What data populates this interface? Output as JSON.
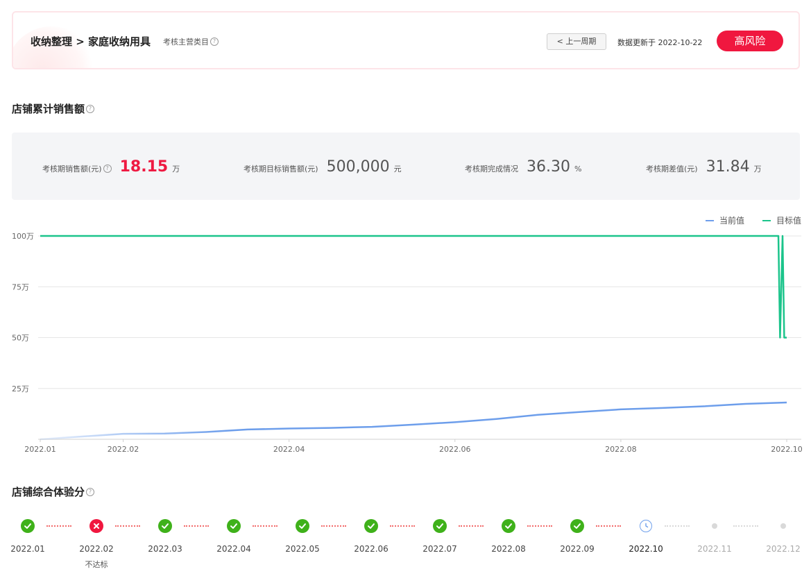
{
  "header": {
    "breadcrumb": "收纳整理 > 家庭收纳用具",
    "category_label": "考核主营类目",
    "prev_period_button": "< 上一周期",
    "update_text": "数据更新于 2022-10-22",
    "risk_button": "高风险",
    "risk_color": "#f0173f"
  },
  "sales_section": {
    "title": "店铺累计销售额",
    "metrics": [
      {
        "label": "考核期销售额(元)",
        "value": "18.15",
        "unit": "万",
        "highlight": true,
        "help": true
      },
      {
        "label": "考核期目标销售额(元)",
        "value": "500,000",
        "unit": "元",
        "highlight": false,
        "help": false
      },
      {
        "label": "考核期完成情况",
        "value": "36.30",
        "unit": "%",
        "highlight": false,
        "help": false
      },
      {
        "label": "考核期差值(元)",
        "value": "31.84",
        "unit": "万",
        "highlight": false,
        "help": false
      }
    ]
  },
  "chart_data": {
    "type": "line",
    "y_ticks": [
      "100万",
      "75万",
      "50万",
      "25万"
    ],
    "ylim": [
      0,
      100
    ],
    "x_ticks": [
      "2022.01",
      "2022.02",
      "2022.04",
      "2022.06",
      "2022.08",
      "2022.10"
    ],
    "xlim": [
      0,
      9
    ],
    "grid": true,
    "legend_position": "top-right",
    "series": [
      {
        "name": "当前值",
        "color": "#6d9eeb",
        "x": [
          0,
          1,
          1.5,
          2,
          2.5,
          3,
          3.5,
          4,
          4.5,
          5,
          5.5,
          6,
          6.5,
          7,
          7.5,
          8,
          8.5,
          9
        ],
        "y": [
          0,
          2.7,
          2.8,
          3.6,
          4.8,
          5.3,
          5.6,
          6.1,
          7.2,
          8.4,
          10.0,
          12.0,
          13.4,
          14.7,
          15.4,
          16.2,
          17.4,
          18.1
        ]
      },
      {
        "name": "目标值",
        "color": "#1bc48b",
        "x": [
          0,
          8.9,
          8.92,
          8.95,
          8.97,
          9
        ],
        "y": [
          100,
          100,
          50,
          100,
          50,
          50
        ]
      }
    ]
  },
  "experience_section": {
    "title": "店铺综合体验分",
    "steps": [
      {
        "month": "2022.01",
        "status": "pass",
        "note": ""
      },
      {
        "month": "2022.02",
        "status": "fail",
        "note": "不达标"
      },
      {
        "month": "2022.03",
        "status": "pass",
        "note": ""
      },
      {
        "month": "2022.04",
        "status": "pass",
        "note": ""
      },
      {
        "month": "2022.05",
        "status": "pass",
        "note": ""
      },
      {
        "month": "2022.06",
        "status": "pass",
        "note": ""
      },
      {
        "month": "2022.07",
        "status": "pass",
        "note": ""
      },
      {
        "month": "2022.08",
        "status": "pass",
        "note": ""
      },
      {
        "month": "2022.09",
        "status": "pass",
        "note": ""
      },
      {
        "month": "2022.10",
        "status": "current",
        "note": ""
      },
      {
        "month": "2022.11",
        "status": "future",
        "note": ""
      },
      {
        "month": "2022.12",
        "status": "future",
        "note": ""
      }
    ],
    "colors": {
      "pass": "#3fb11a",
      "fail": "#f0173f",
      "current": "#6d9eeb",
      "future": "#d9d9d9",
      "dots_done": "#f26b6b",
      "dots_future": "#d9d9d9"
    }
  }
}
